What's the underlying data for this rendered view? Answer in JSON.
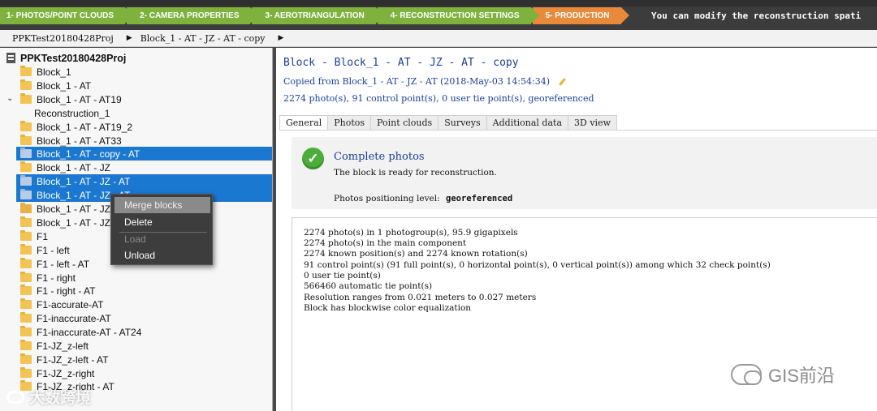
{
  "workflow": {
    "steps": [
      {
        "label": "1- PHOTOS/POINT CLOUDS"
      },
      {
        "label": "2- CAMERA PROPERTIES"
      },
      {
        "label": "3- AEROTRIANGULATION"
      },
      {
        "label": "4- RECONSTRUCTION SETTINGS"
      },
      {
        "label": "5- PRODUCTION"
      }
    ],
    "message": "You can modify the reconstruction spati"
  },
  "breadcrumb": {
    "project": "PPKTest20180428Proj",
    "block": "Block_1 - AT - JZ - AT - copy"
  },
  "tree": {
    "root": "PPKTest20180428Proj",
    "items": [
      {
        "label": "Block_1"
      },
      {
        "label": "Block_1 - AT"
      },
      {
        "label": "Block_1 - AT - AT19"
      },
      {
        "label": "Reconstruction_1"
      },
      {
        "label": "Block_1 - AT - AT19_2"
      },
      {
        "label": "Block_1 - AT - AT33"
      },
      {
        "label": "Block_1 - AT - copy - AT"
      },
      {
        "label": "Block_1 - AT - JZ"
      },
      {
        "label": "Block_1 - AT - JZ - AT"
      },
      {
        "label": "Block_1 - AT - JZ - AT"
      },
      {
        "label": "Block_1 - AT - JZ"
      },
      {
        "label": "Block_1 - AT - JZ"
      },
      {
        "label": "F1"
      },
      {
        "label": "F1 - left"
      },
      {
        "label": "F1 - left - AT"
      },
      {
        "label": "F1 - right"
      },
      {
        "label": "F1 - right - AT"
      },
      {
        "label": "F1-accurate-AT"
      },
      {
        "label": "F1-inaccurate-AT"
      },
      {
        "label": "F1-inaccurate-AT - AT24"
      },
      {
        "label": "F1-JZ_z-left"
      },
      {
        "label": "F1-JZ_z-left - AT"
      },
      {
        "label": "F1-JZ_z-right"
      },
      {
        "label": "F1-JZ_z-right - AT"
      }
    ]
  },
  "context_menu": {
    "items": [
      {
        "label": "Merge blocks"
      },
      {
        "label": "Delete"
      },
      {
        "label": "Load"
      },
      {
        "label": "Unload"
      }
    ]
  },
  "block": {
    "title": "Block - Block_1 - AT - JZ - AT - copy",
    "copied_from": "Copied from Block_1 - AT - JZ - AT (2018-May-03 14:54:34)",
    "summary": "2274 photo(s), 91 control point(s), 0 user tie point(s), georeferenced"
  },
  "tabs": [
    {
      "label": "General"
    },
    {
      "label": "Photos"
    },
    {
      "label": "Point clouds"
    },
    {
      "label": "Surveys"
    },
    {
      "label": "Additional data"
    },
    {
      "label": "3D view"
    }
  ],
  "status": {
    "title": "Complete photos",
    "description": "The block is ready for reconstruction.",
    "positioning_label": "Photos positioning level:",
    "positioning_value": "georeferenced"
  },
  "details": [
    "2274 photo(s) in 1 photogroup(s), 95.9 gigapixels",
    "2274 photo(s) in the main component",
    "2274 known position(s) and 2274 known rotation(s)",
    "91 control point(s) (91 full point(s), 0 horizontal point(s), 0 vertical point(s)) among which 32 check point(s)",
    "0 user tie point(s)",
    "566460 automatic tie point(s)",
    "Resolution ranges from 0.021 meters to 0.027 meters",
    "Block has blockwise color equalization"
  ],
  "watermarks": {
    "left": "大数跨境",
    "right": "GIS前沿"
  }
}
